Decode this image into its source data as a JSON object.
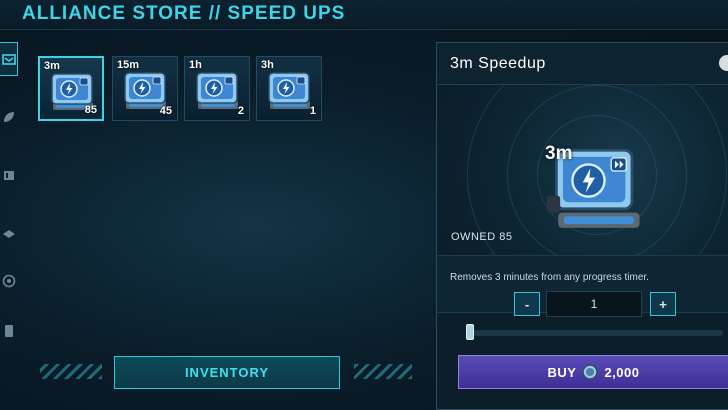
{
  "header": {
    "title": "ALLIANCE STORE // SPEED UPS"
  },
  "leftnav": {
    "items": [
      {
        "icon": "store-box-icon",
        "active": true
      },
      {
        "icon": "leaf-icon",
        "active": false
      },
      {
        "icon": "crate-icon",
        "active": false
      },
      {
        "icon": "blocks-icon",
        "active": false
      },
      {
        "icon": "target-icon",
        "active": false
      },
      {
        "icon": "scroll-icon",
        "active": false
      }
    ]
  },
  "items": [
    {
      "label": "3m",
      "qty": "85",
      "selected": true
    },
    {
      "label": "15m",
      "qty": "45",
      "selected": false
    },
    {
      "label": "1h",
      "qty": "2",
      "selected": false
    },
    {
      "label": "3h",
      "qty": "1",
      "selected": false
    }
  ],
  "inventory": {
    "label": "INVENTORY"
  },
  "detail": {
    "title": "3m Speedup",
    "tag": "3m",
    "owned": "OWNED 85",
    "description": "Removes 3 minutes from any progress timer.",
    "decrement": "-",
    "increment": "+",
    "quantity": "1",
    "slider_fraction": 0.0,
    "buy_label": "BUY",
    "price": "2,000"
  },
  "colors": {
    "accent": "#3fd3e6",
    "buy": "#4b3ca8",
    "background": "#0a1d29"
  }
}
